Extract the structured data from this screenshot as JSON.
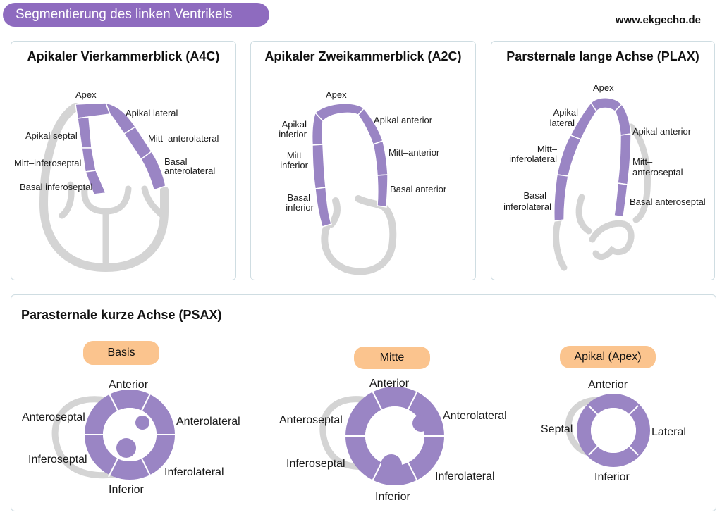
{
  "header": {
    "title": "Segmentierung des linken Ventrikels",
    "site": "www.ekgecho.de"
  },
  "colors": {
    "segment": "#9a85c4",
    "segment_border": "#ffffff",
    "wall": "#d4d4d4",
    "pill": "#fbc48e",
    "title_bg": "#8e6bbf"
  },
  "a4c": {
    "title": "Apikaler Vierkammerblick (A4C)",
    "labels": {
      "apex": "Apex",
      "apical_lateral": "Apikal lateral",
      "mid_anterolateral": "Mitt–anterolateral",
      "basal_anterolateral_1": "Basal",
      "basal_anterolateral_2": "anterolateral",
      "apical_septal": "Apikal septal",
      "mid_inferoseptal": "Mitt–inferoseptal",
      "basal_inferoseptal": "Basal inferoseptal"
    }
  },
  "a2c": {
    "title": "Apikaler Zweikammerblick (A2C)",
    "labels": {
      "apex": "Apex",
      "apical_inferior_1": "Apikal",
      "apical_inferior_2": "inferior",
      "mid_inferior_1": "Mitt–",
      "mid_inferior_2": "inferior",
      "basal_inferior_1": "Basal",
      "basal_inferior_2": "inferior",
      "apical_anterior": "Apikal anterior",
      "mid_anterior": "Mitt–anterior",
      "basal_anterior": "Basal anterior"
    }
  },
  "plax": {
    "title": "Parsternale lange Achse (PLAX)",
    "labels": {
      "apex": "Apex",
      "apical_lateral_1": "Apikal",
      "apical_lateral_2": "lateral",
      "mid_inferolateral_1": "Mitt–",
      "mid_inferolateral_2": "inferolateral",
      "basal_inferolateral_1": "Basal",
      "basal_inferolateral_2": "inferolateral",
      "apical_anterior": "Apikal anterior",
      "mid_anteroseptal_1": "Mitt–",
      "mid_anteroseptal_2": "anteroseptal",
      "basal_anteroseptal": "Basal anteroseptal"
    }
  },
  "psax": {
    "title": "Parasternale kurze Achse (PSAX)",
    "basis": {
      "pill": "Basis",
      "anterior": "Anterior",
      "anteroseptal": "Anteroseptal",
      "anterolateral": "Anterolateral",
      "inferoseptal": "Inferoseptal",
      "inferolateral": "Inferolateral",
      "inferior": "Inferior"
    },
    "mitte": {
      "pill": "Mitte",
      "anterior": "Anterior",
      "anteroseptal": "Anteroseptal",
      "anterolateral": "Anterolateral",
      "inferoseptal": "Inferoseptal",
      "inferolateral": "Inferolateral",
      "inferior": "Inferior"
    },
    "apex": {
      "pill": "Apikal (Apex)",
      "anterior": "Anterior",
      "septal": "Septal",
      "lateral": "Lateral",
      "inferior": "Inferior"
    }
  }
}
